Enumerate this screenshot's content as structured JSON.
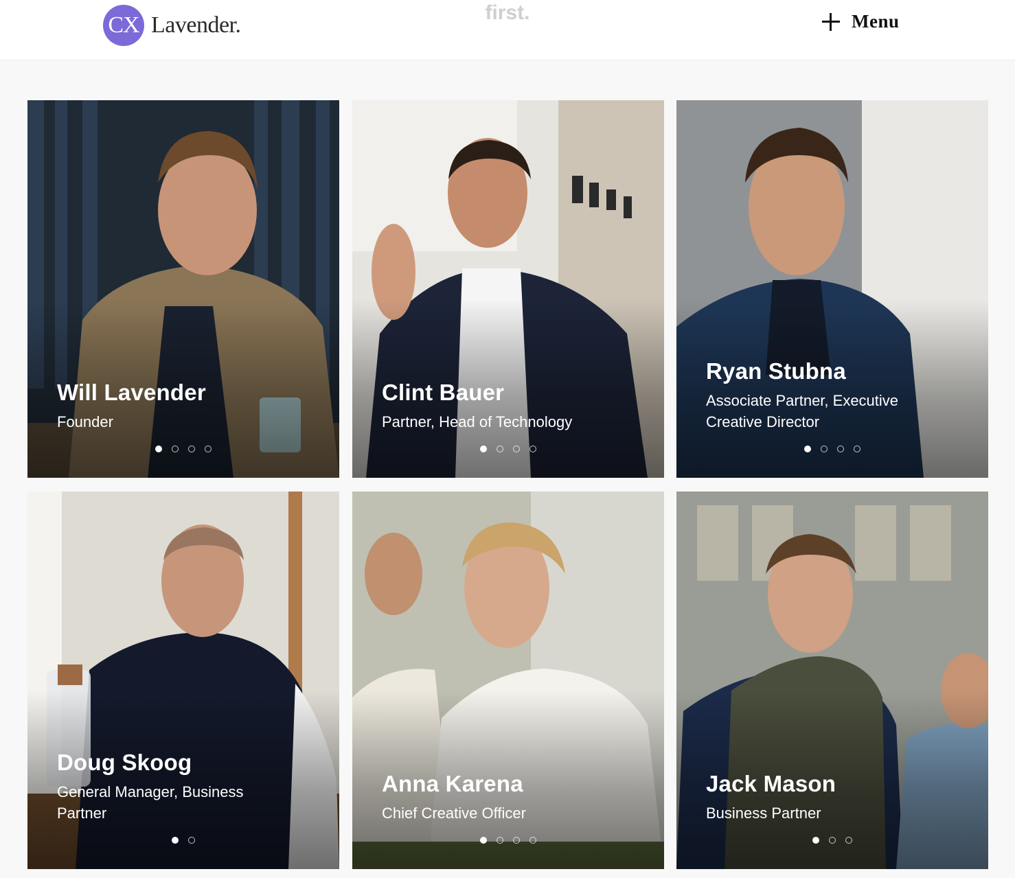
{
  "header": {
    "logo_mark": "CX",
    "logo_word": "Lavender.",
    "tagline_fragment": "first.",
    "menu_label": "Menu"
  },
  "team": [
    {
      "name": "Will Lavender",
      "role": "Founder",
      "slides": 4,
      "active_slide": 1
    },
    {
      "name": "Clint Bauer",
      "role": "Partner, Head of Technology",
      "slides": 4,
      "active_slide": 1
    },
    {
      "name": "Ryan Stubna",
      "role": "Associate Partner, Executive Creative Director",
      "slides": 4,
      "active_slide": 1
    },
    {
      "name": "Doug Skoog",
      "role": "General Manager, Business Partner",
      "slides": 2,
      "active_slide": 1
    },
    {
      "name": "Anna Karena",
      "role": "Chief Creative Officer",
      "slides": 4,
      "active_slide": 1
    },
    {
      "name": "Jack Mason",
      "role": "Business Partner",
      "slides": 3,
      "active_slide": 1
    }
  ],
  "colors": {
    "brand": "#7b6ad8",
    "background": "#f8f8f8"
  }
}
